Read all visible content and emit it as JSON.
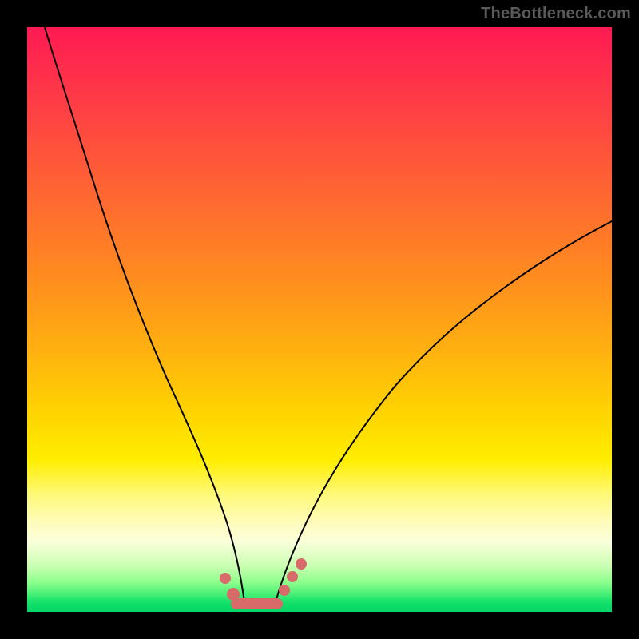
{
  "watermark": "TheBottleneck.com",
  "colors": {
    "background": "#000000",
    "marker": "#d86a6a",
    "curve": "#000000"
  },
  "chart_data": {
    "type": "line",
    "title": "",
    "xlabel": "",
    "ylabel": "",
    "xlim": [
      0,
      100
    ],
    "ylim": [
      0,
      100
    ],
    "grid": false,
    "legend": false,
    "background_gradient": {
      "top": "#ff1a52",
      "middle": "#ffee00",
      "bottom": "#04d866"
    },
    "series": [
      {
        "name": "left-branch",
        "x": [
          3,
          6,
          10,
          14,
          18,
          22,
          26,
          29,
          31,
          33,
          35,
          36.5
        ],
        "y": [
          100,
          88,
          74,
          60.5,
          47.5,
          35,
          23.5,
          14.5,
          9,
          5,
          2.2,
          0.9
        ]
      },
      {
        "name": "right-branch",
        "x": [
          42.5,
          44,
          46,
          50,
          56,
          64,
          74,
          86,
          100
        ],
        "y": [
          0.9,
          2.7,
          6.2,
          13.8,
          23.5,
          34,
          44.5,
          54.5,
          63.5
        ]
      },
      {
        "name": "valley-floor",
        "x": [
          36.5,
          42.5
        ],
        "y": [
          0.9,
          0.9
        ]
      }
    ],
    "markers": [
      {
        "name": "left-dot-1",
        "x": 33.0,
        "y": 5.0,
        "r": 7
      },
      {
        "name": "left-dot-2",
        "x": 35.0,
        "y": 2.3,
        "r": 8
      },
      {
        "name": "right-dot-1",
        "x": 44.0,
        "y": 2.7,
        "r": 7
      },
      {
        "name": "right-dot-2",
        "x": 45.5,
        "y": 5.0,
        "r": 7
      },
      {
        "name": "right-dot-3",
        "x": 47.0,
        "y": 7.6,
        "r": 7
      },
      {
        "name": "valley-bar",
        "shape": "capsule",
        "x1": 35.5,
        "x2": 43.0,
        "y": 0.9,
        "thickness": 14
      }
    ]
  }
}
